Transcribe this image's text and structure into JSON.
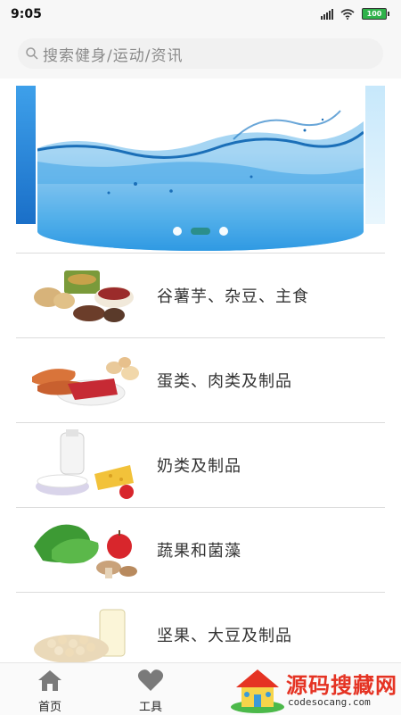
{
  "status_bar": {
    "time": "9:05",
    "battery": "100"
  },
  "search": {
    "placeholder": "搜索健身/运动/资讯"
  },
  "banner": {
    "page_count": 3,
    "active_index": 1
  },
  "categories": [
    {
      "label": "谷薯芋、杂豆、主食",
      "icon": "grains-image"
    },
    {
      "label": "蛋类、肉类及制品",
      "icon": "meat-eggs-image"
    },
    {
      "label": "奶类及制品",
      "icon": "dairy-image"
    },
    {
      "label": "蔬果和菌藻",
      "icon": "vegetables-fruit-image"
    },
    {
      "label": "坚果、大豆及制品",
      "icon": "nuts-beans-image"
    }
  ],
  "bottom_nav": {
    "home_label": "首页",
    "tools_label": "工具"
  },
  "watermark": {
    "title": "源码搜藏网",
    "url": "codesocang.com"
  },
  "colors": {
    "battery": "#2fb24a",
    "active_dot": "#2a8c86",
    "watermark_red": "#e53323"
  }
}
